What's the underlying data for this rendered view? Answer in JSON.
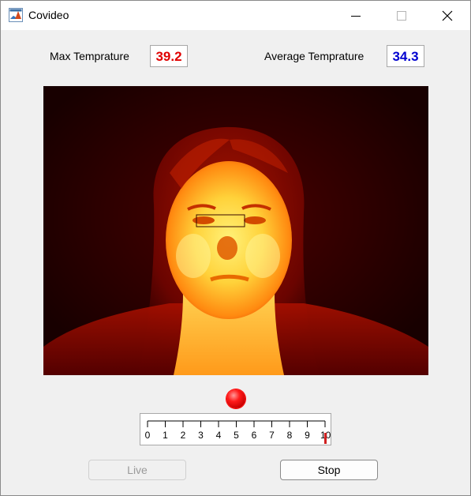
{
  "window": {
    "title": "Covideo",
    "controls": [
      "minimize",
      "maximize",
      "close"
    ]
  },
  "readings": {
    "max_label": "Max Temprature",
    "max_value": "39.2",
    "max_color": "#e00000",
    "avg_label": "Average Temprature",
    "avg_value": "34.3",
    "avg_color": "#0000d0"
  },
  "image": {
    "content": "thermal-camera-feed",
    "palette": "hot"
  },
  "indicator": {
    "state": "recording",
    "color": "#ff0000"
  },
  "slider": {
    "tick_labels": [
      "0",
      "1",
      "2",
      "3",
      "4",
      "5",
      "6",
      "7",
      "8",
      "9",
      "10"
    ],
    "value": 10,
    "min": 0,
    "max": 10
  },
  "buttons": {
    "live_label": "Live",
    "live_enabled": false,
    "stop_label": "Stop",
    "stop_enabled": true
  }
}
